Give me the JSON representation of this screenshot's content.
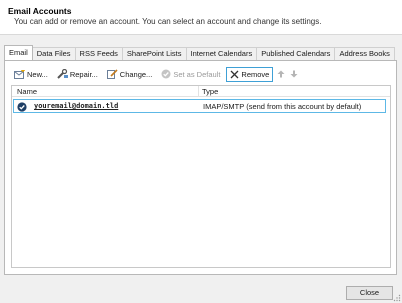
{
  "header": {
    "title": "Email Accounts",
    "description": "You can add or remove an account. You can select an account and change its settings."
  },
  "tabs": [
    {
      "label": "Email",
      "active": true
    },
    {
      "label": "Data Files"
    },
    {
      "label": "RSS Feeds"
    },
    {
      "label": "SharePoint Lists"
    },
    {
      "label": "Internet Calendars"
    },
    {
      "label": "Published Calendars"
    },
    {
      "label": "Address Books"
    }
  ],
  "toolbar": {
    "new_label": "New...",
    "repair_label": "Repair...",
    "change_label": "Change...",
    "set_default_label": "Set as Default",
    "remove_label": "Remove"
  },
  "list": {
    "columns": {
      "name": "Name",
      "type": "Type"
    },
    "rows": [
      {
        "name": "youremail@domain.tld",
        "type": "IMAP/SMTP (send from this account by default)"
      }
    ]
  },
  "footer": {
    "close_label": "Close"
  },
  "colors": {
    "focus": "#3ea0d6",
    "selection": "#5db8e6",
    "default_check": "#1f3f66"
  }
}
